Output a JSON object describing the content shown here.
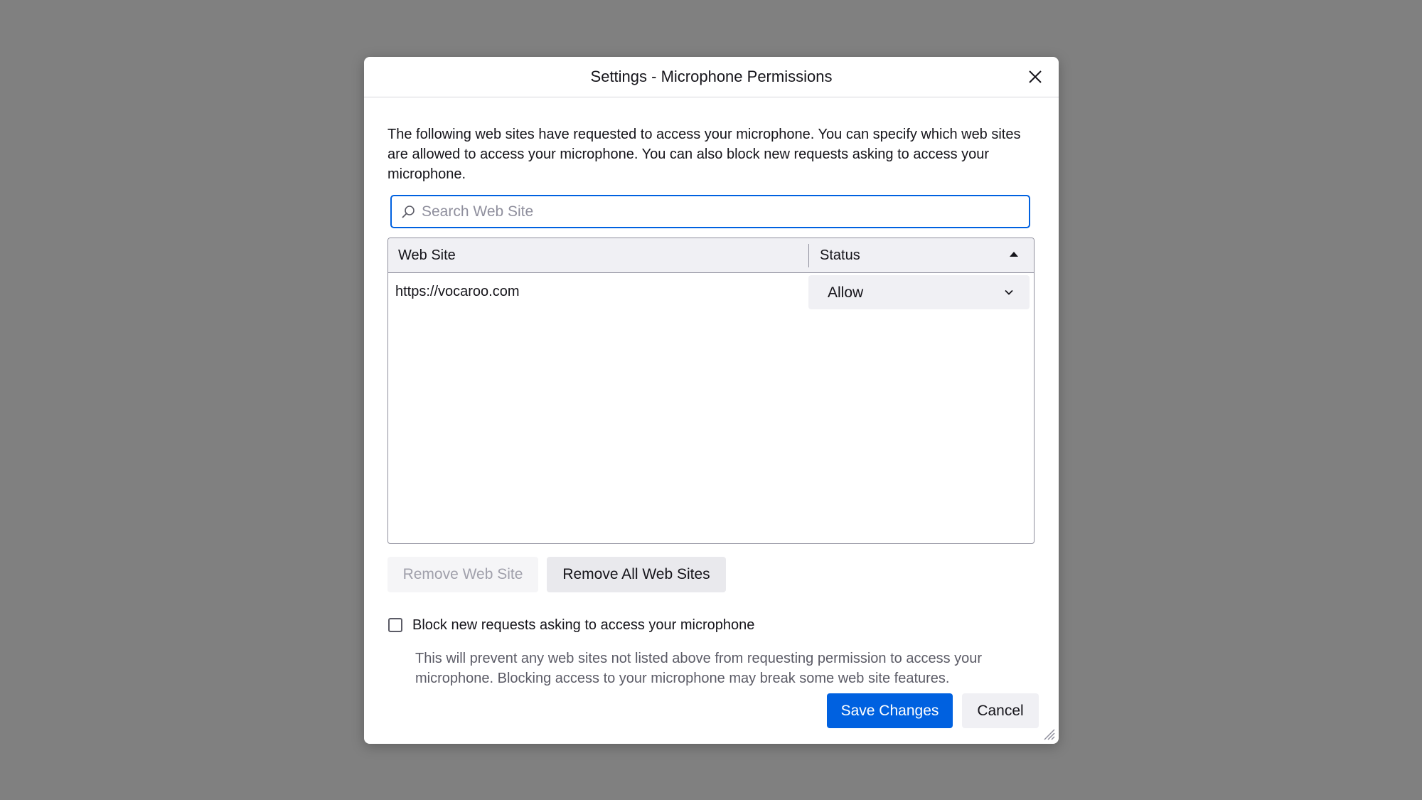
{
  "dialog": {
    "title": "Settings - Microphone Permissions",
    "intro": "The following web sites have requested to access your microphone. You can specify which web sites are allowed to access your microphone. You can also block new requests asking to access your microphone."
  },
  "search": {
    "placeholder": "Search Web Site",
    "value": "",
    "icon": "search-icon"
  },
  "table": {
    "columns": [
      "Web Site",
      "Status"
    ],
    "sort_column": "Status",
    "sort_direction": "ascending",
    "rows": [
      {
        "site": "https://vocaroo.com",
        "status": "Allow"
      }
    ]
  },
  "buttons": {
    "remove": "Remove Web Site",
    "remove_all": "Remove All Web Sites",
    "save": "Save Changes",
    "cancel": "Cancel"
  },
  "block": {
    "label": "Block new requests asking to access your microphone",
    "checked": false,
    "description": "This will prevent any web sites not listed above from requesting permission to access your microphone. Blocking access to your microphone may break some web site features."
  },
  "colors": {
    "accent": "#0061e0",
    "backdrop": "#808080",
    "button_bg": "#f0f0f4"
  }
}
